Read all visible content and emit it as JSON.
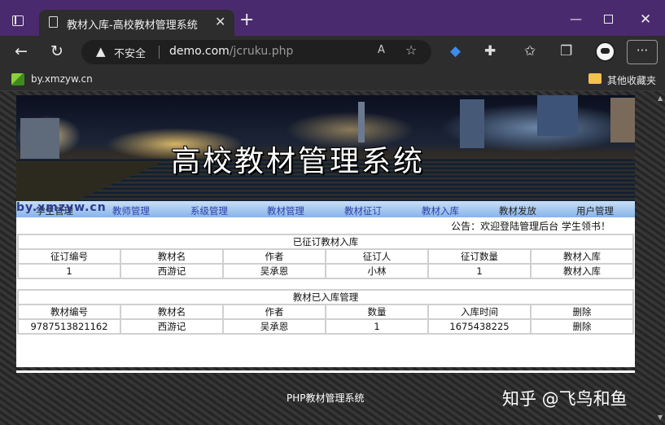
{
  "browser": {
    "tab_title": "教材入库-高校教材管理系统",
    "tab_close": "✕",
    "new_tab": "+",
    "window_minimize": "—",
    "window_close": "✕",
    "address": {
      "security_label": "不安全",
      "url_host": "demo.com",
      "url_path": "/jcruku.php"
    },
    "read_aloud": "A",
    "more": "···"
  },
  "bookmarks": {
    "item_label": "by.xmzyw.cn",
    "other_label": "其他收藏夹"
  },
  "banner": {
    "title": "高校教材管理系统"
  },
  "watermark": "by.xmzyw.cn",
  "menu": {
    "items": [
      "学生管理",
      "教师管理",
      "系级管理",
      "教材管理",
      "教材征订",
      "教材入库",
      "教材发放",
      "用户管理"
    ]
  },
  "notice": "公告：欢迎登陆管理后台 学生领书！",
  "ordered_table": {
    "title": "已征订教材入库",
    "headers": [
      "征订编号",
      "教材名",
      "作者",
      "征订人",
      "征订数量",
      "教材入库"
    ],
    "rows": [
      [
        "1",
        "西游记",
        "吴承恩",
        "小林",
        "1",
        "教材入库"
      ]
    ]
  },
  "stock_table": {
    "title": "教材已入库管理",
    "headers": [
      "教材编号",
      "教材名",
      "作者",
      "数量",
      "入库时间",
      "删除"
    ],
    "rows": [
      [
        "9787513821162",
        "西游记",
        "吴承恩",
        "1",
        "1675438225",
        "删除"
      ]
    ]
  },
  "footer": "PHP教材管理系统",
  "zhihu_watermark": "知乎 @飞鸟和鱼",
  "colors": {
    "titlebar": "#4a2a6e",
    "menu_link": "#2b3ea8"
  }
}
